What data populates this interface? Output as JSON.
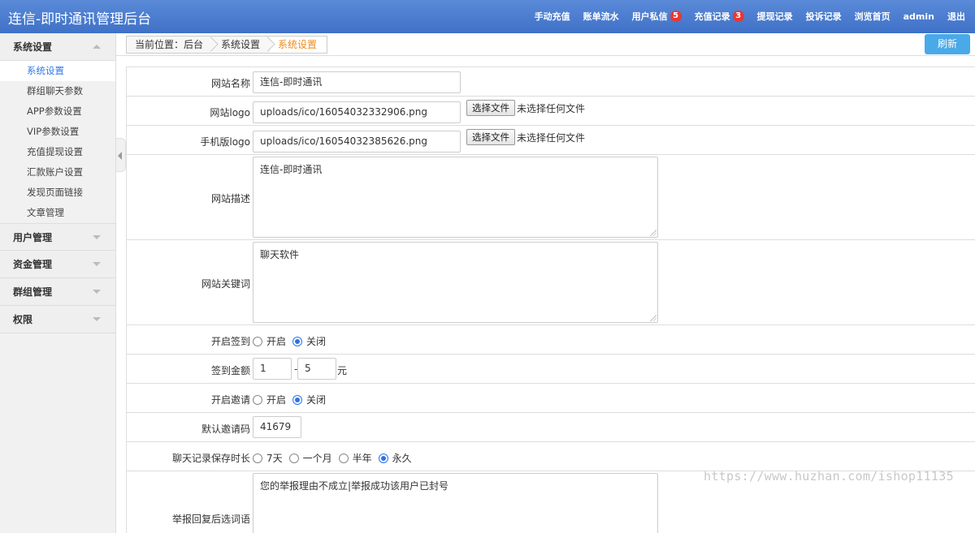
{
  "header": {
    "title": "连信-即时通讯管理后台",
    "nav": [
      {
        "label": "手动充值"
      },
      {
        "label": "账单流水"
      },
      {
        "label": "用户私信",
        "badge": "5"
      },
      {
        "label": "充值记录",
        "badge": "3"
      },
      {
        "label": "提现记录"
      },
      {
        "label": "投诉记录"
      },
      {
        "label": "浏览首页"
      },
      {
        "label": "admin"
      },
      {
        "label": "退出"
      }
    ]
  },
  "sidebar": {
    "groups": [
      {
        "label": "系统设置",
        "expanded": true,
        "items": [
          "系统设置",
          "群组聊天参数",
          "APP参数设置",
          "VIP参数设置",
          "充值提现设置",
          "汇款账户设置",
          "发现页面链接",
          "文章管理"
        ],
        "active_index": 0
      },
      {
        "label": "用户管理",
        "expanded": false
      },
      {
        "label": "资金管理",
        "expanded": false
      },
      {
        "label": "群组管理",
        "expanded": false
      },
      {
        "label": "权限",
        "expanded": false
      }
    ]
  },
  "breadcrumb": {
    "items": [
      "当前位置：后台",
      "系统设置",
      "系统设置"
    ],
    "refresh_label": "刷新"
  },
  "form": {
    "site_name": {
      "label": "网站名称",
      "value": "连信-即时通讯"
    },
    "site_logo": {
      "label": "网站logo",
      "value": "uploads/ico/16054032332906.png",
      "button": "选择文件",
      "note": "未选择任何文件"
    },
    "mobile_logo": {
      "label": "手机版logo",
      "value": "uploads/ico/16054032385626.png",
      "button": "选择文件",
      "note": "未选择任何文件"
    },
    "site_desc": {
      "label": "网站描述",
      "value": "连信-即时通讯"
    },
    "site_keywords": {
      "label": "网站关键词",
      "value": "聊天软件"
    },
    "checkin_enabled": {
      "label": "开启签到",
      "options": [
        "开启",
        "关闭"
      ],
      "selected": "关闭"
    },
    "checkin_amount": {
      "label": "签到金额",
      "min": "1",
      "sep": "-",
      "max": "5",
      "unit": "元"
    },
    "invite_enabled": {
      "label": "开启邀请",
      "options": [
        "开启",
        "关闭"
      ],
      "selected": "关闭"
    },
    "default_invite_code": {
      "label": "默认邀请码",
      "value": "41679"
    },
    "chat_retention": {
      "label": "聊天记录保存时长",
      "options": [
        "7天",
        "一个月",
        "半年",
        "永久"
      ],
      "selected": "永久"
    },
    "report_reply_options": {
      "label": "举报回复后选词语",
      "value": "您的举报理由不成立|举报成功该用户已封号"
    }
  },
  "watermark": "https://www.huzhan.com/ishop11135",
  "colors": {
    "header": "#3f71c7",
    "accent": "#2f78e8",
    "refresh": "#4aa9e9",
    "badge": "#e53935",
    "current_crumb": "#ee8b1b"
  }
}
